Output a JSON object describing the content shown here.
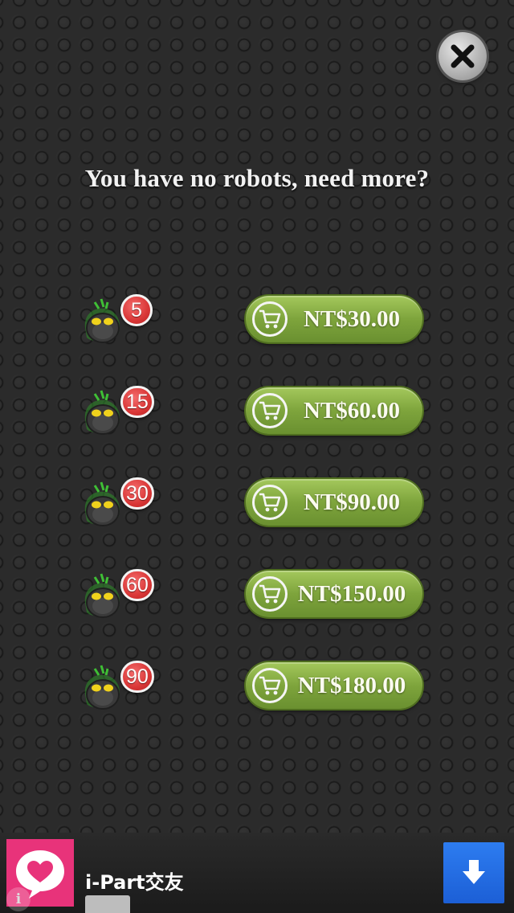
{
  "headline": "You have no robots, need more?",
  "close": {
    "icon": "close-icon"
  },
  "packs": [
    {
      "count": "5",
      "price": "NT$30.00"
    },
    {
      "count": "15",
      "price": "NT$60.00"
    },
    {
      "count": "30",
      "price": "NT$90.00"
    },
    {
      "count": "60",
      "price": "NT$150.00"
    },
    {
      "count": "90",
      "price": "NT$180.00"
    }
  ],
  "ad": {
    "title": "i-Part交友",
    "info_glyph": "i",
    "download_icon": "download-arrow-icon"
  },
  "colors": {
    "button_green": "#7ea43c",
    "badge_red": "#d93636",
    "ad_pink": "#e8337a",
    "ad_blue": "#1c5fd6"
  }
}
